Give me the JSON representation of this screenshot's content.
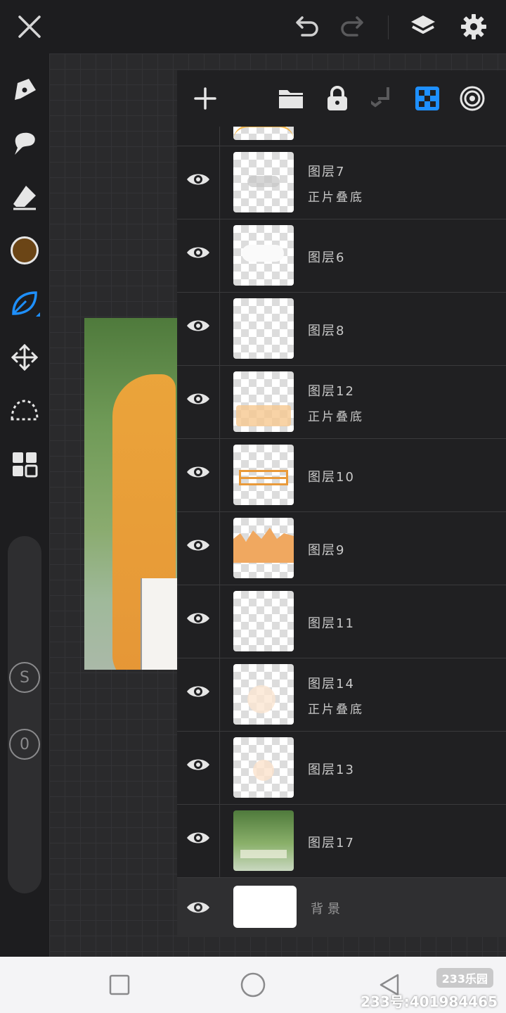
{
  "toolbar": {
    "icons": [
      "close-icon",
      "undo-icon",
      "redo-icon",
      "layers-icon",
      "settings-icon"
    ]
  },
  "tools": {
    "items": [
      "pen-icon",
      "brush-icon",
      "eraser-icon",
      "color-swatch",
      "leaf-brush-icon",
      "move-icon",
      "lasso-icon",
      "grid-icon"
    ],
    "current_color": "#6b4516",
    "accent": "#1e90ff",
    "size_label": "S",
    "opacity_label": "0"
  },
  "layers_panel": {
    "toolbar_icons": [
      "add-icon",
      "folder-icon",
      "lock-icon",
      "merge-down-icon",
      "transparency-icon",
      "clipping-icon"
    ],
    "layers": [
      {
        "name": "图层7",
        "mode": "正片叠底",
        "thumb": "gray-cloud"
      },
      {
        "name": "图层6",
        "mode": "",
        "thumb": "white-cloud"
      },
      {
        "name": "图层8",
        "mode": "",
        "thumb": "faint"
      },
      {
        "name": "图层12",
        "mode": "正片叠底",
        "thumb": "orange-strip"
      },
      {
        "name": "图层10",
        "mode": "",
        "thumb": "orange-lines"
      },
      {
        "name": "图层9",
        "mode": "",
        "thumb": "orange-fill"
      },
      {
        "name": "图层11",
        "mode": "",
        "thumb": "faint"
      },
      {
        "name": "图层14",
        "mode": "正片叠底",
        "thumb": "peach-faint"
      },
      {
        "name": "图层13",
        "mode": "",
        "thumb": "peach-faint"
      },
      {
        "name": "图层17",
        "mode": "",
        "thumb": "green-scene"
      },
      {
        "name": "背景",
        "mode": "",
        "thumb": "white"
      }
    ]
  },
  "navbar": {
    "icons": [
      "recents-icon",
      "home-icon",
      "back-icon"
    ]
  },
  "watermark": {
    "brand": "233乐园",
    "id": "233号:401984465"
  }
}
